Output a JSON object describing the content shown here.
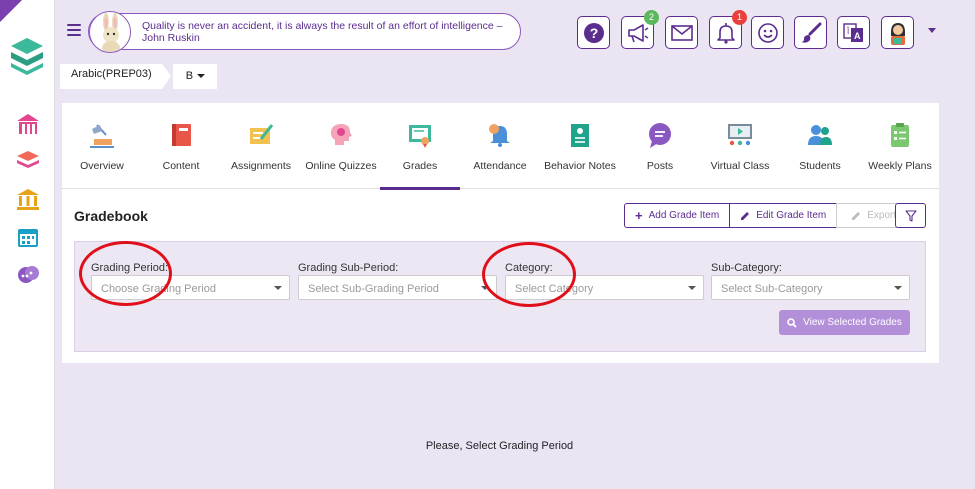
{
  "colors": {
    "brand_purple": "#5b2d8f",
    "accent_light": "#b48fd9",
    "annotation_red": "#e0101a"
  },
  "sidebar": {
    "items": [
      {
        "name": "home-icon",
        "color": "#e2468f"
      },
      {
        "name": "books-icon",
        "color": "#e2468f"
      },
      {
        "name": "institution-icon",
        "color": "#e8a21b"
      },
      {
        "name": "calendar-icon",
        "color": "#1aa0c6"
      },
      {
        "name": "chat-icon",
        "color": "#8b58c2"
      }
    ]
  },
  "header": {
    "quote": "Quality is never an accident, it is always the result of an effort of intelligence – John Ruskin",
    "icons": [
      {
        "name": "help-icon"
      },
      {
        "name": "announcement-icon",
        "badge": "2"
      },
      {
        "name": "mail-icon"
      },
      {
        "name": "bell-icon",
        "badge": "1"
      },
      {
        "name": "smiley-icon"
      },
      {
        "name": "brush-icon"
      },
      {
        "name": "translate-icon"
      },
      {
        "name": "user-avatar-icon"
      }
    ]
  },
  "course": {
    "name": "Arabic(PREP03)",
    "section": "B"
  },
  "tabs": [
    {
      "label": "Overview"
    },
    {
      "label": "Content"
    },
    {
      "label": "Assignments"
    },
    {
      "label": "Online Quizzes"
    },
    {
      "label": "Grades",
      "active": true
    },
    {
      "label": "Attendance"
    },
    {
      "label": "Behavior Notes"
    },
    {
      "label": "Posts"
    },
    {
      "label": "Virtual Class"
    },
    {
      "label": "Students"
    },
    {
      "label": "Weekly Plans"
    }
  ],
  "gradebook": {
    "title": "Gradebook",
    "add_label": "Add Grade Item",
    "edit_label": "Edit Grade Item",
    "export_label": "Export",
    "filters": {
      "period_label": "Grading Period:",
      "period_placeholder": "Choose Grading Period",
      "subperiod_label": "Grading Sub-Period:",
      "subperiod_placeholder": "Select Sub-Grading Period",
      "category_label": "Category:",
      "category_placeholder": "Select Category",
      "subcategory_label": "Sub-Category:",
      "subcategory_placeholder": "Select Sub-Category"
    },
    "view_label": "View Selected Grades",
    "empty_message": "Please, Select Grading Period"
  }
}
